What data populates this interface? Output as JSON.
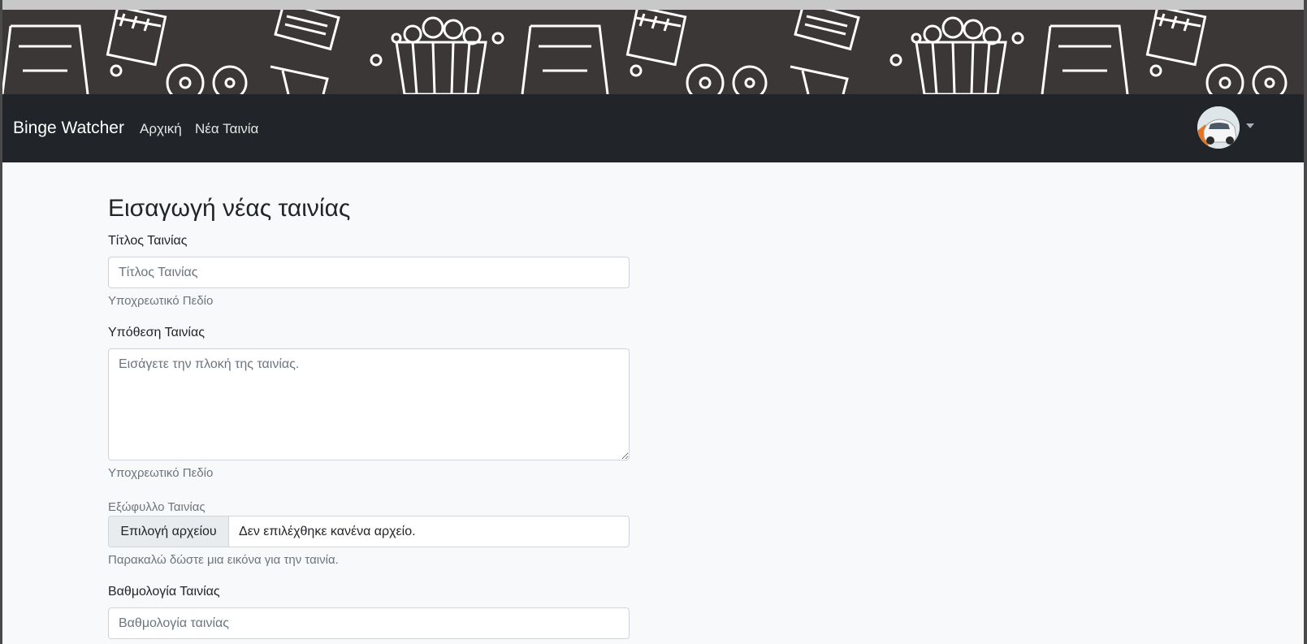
{
  "navbar": {
    "brand": "Binge Watcher",
    "links": [
      {
        "label": "Αρχική"
      },
      {
        "label": "Νέα Ταινία"
      }
    ]
  },
  "form": {
    "heading": "Εισαγωγή νέας ταινίας",
    "title_field": {
      "label": "Τίτλος Ταινίας",
      "placeholder": "Τίτλος Ταινίας",
      "value": "",
      "help": "Υποχρεωτικό Πεδίο"
    },
    "plot_field": {
      "label": "Υπόθεση Ταινίας",
      "placeholder": "Εισάγετε την πλοκή της ταινίας.",
      "value": "",
      "help": "Υποχρεωτικό Πεδίο"
    },
    "cover_field": {
      "label": "Εξώφυλλο Ταινίας",
      "button_label": "Επιλογή αρχείου",
      "file_status": "Δεν επιλέχθηκε κανένα αρχείο.",
      "help": "Παρακαλώ δώστε μια εικόνα για την ταινία."
    },
    "rating_field": {
      "label": "Βαθμολογία Ταινίας",
      "placeholder": "Βαθμολογία ταινίας",
      "value": ""
    }
  },
  "icons": [
    "user-avatar",
    "dropdown-caret",
    "banner-film-pattern"
  ],
  "colors": {
    "navbar_bg": "#212529",
    "page_bg": "#f8f9fa",
    "banner_bg": "#3b3736",
    "muted_text": "#6c757d"
  }
}
